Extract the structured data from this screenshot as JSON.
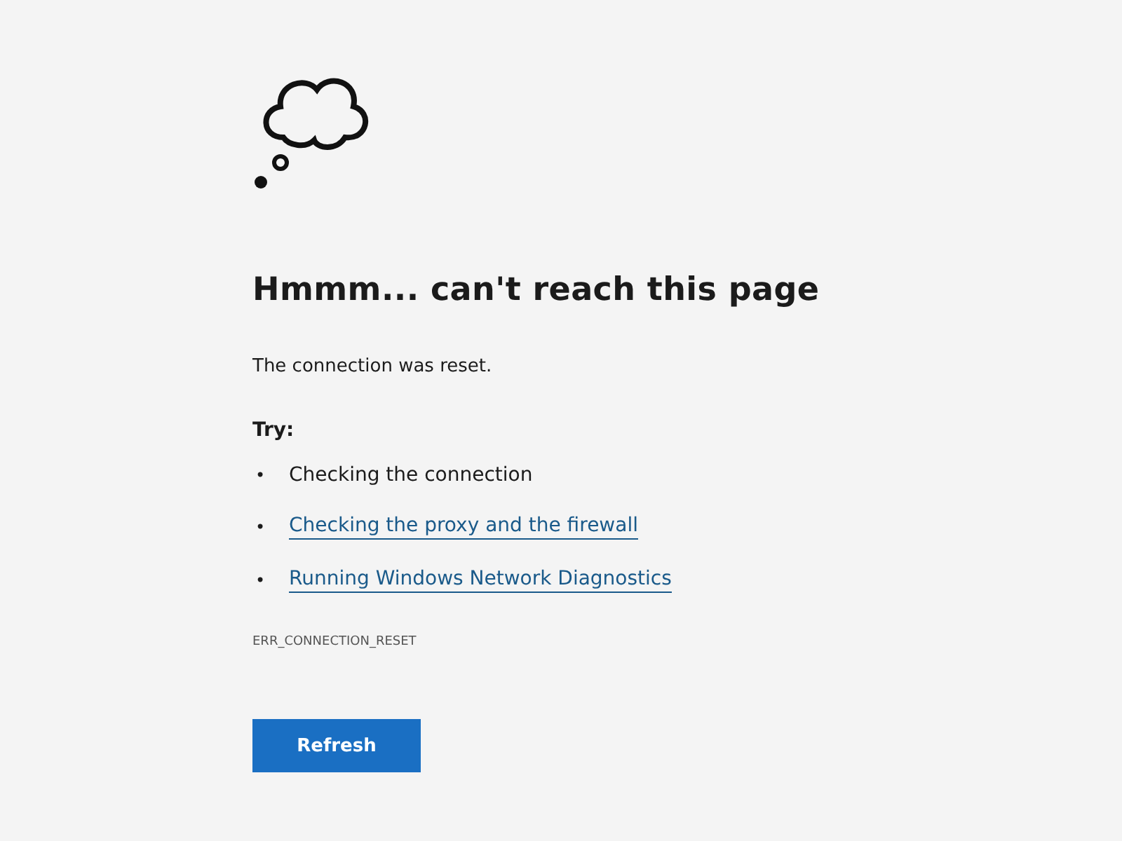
{
  "heading": "Hmmm... can't reach this page",
  "message": "The connection was reset.",
  "try_label": "Try:",
  "suggestions": [
    {
      "kind": "text",
      "bullet": "•",
      "label": "Checking the connection"
    },
    {
      "kind": "link",
      "bullet": "•",
      "label": "Checking the proxy and the firewall"
    },
    {
      "kind": "link",
      "bullet": "•",
      "label": "Running Windows Network Diagnostics"
    }
  ],
  "error_code": "ERR_CONNECTION_RESET",
  "button": "Refresh"
}
